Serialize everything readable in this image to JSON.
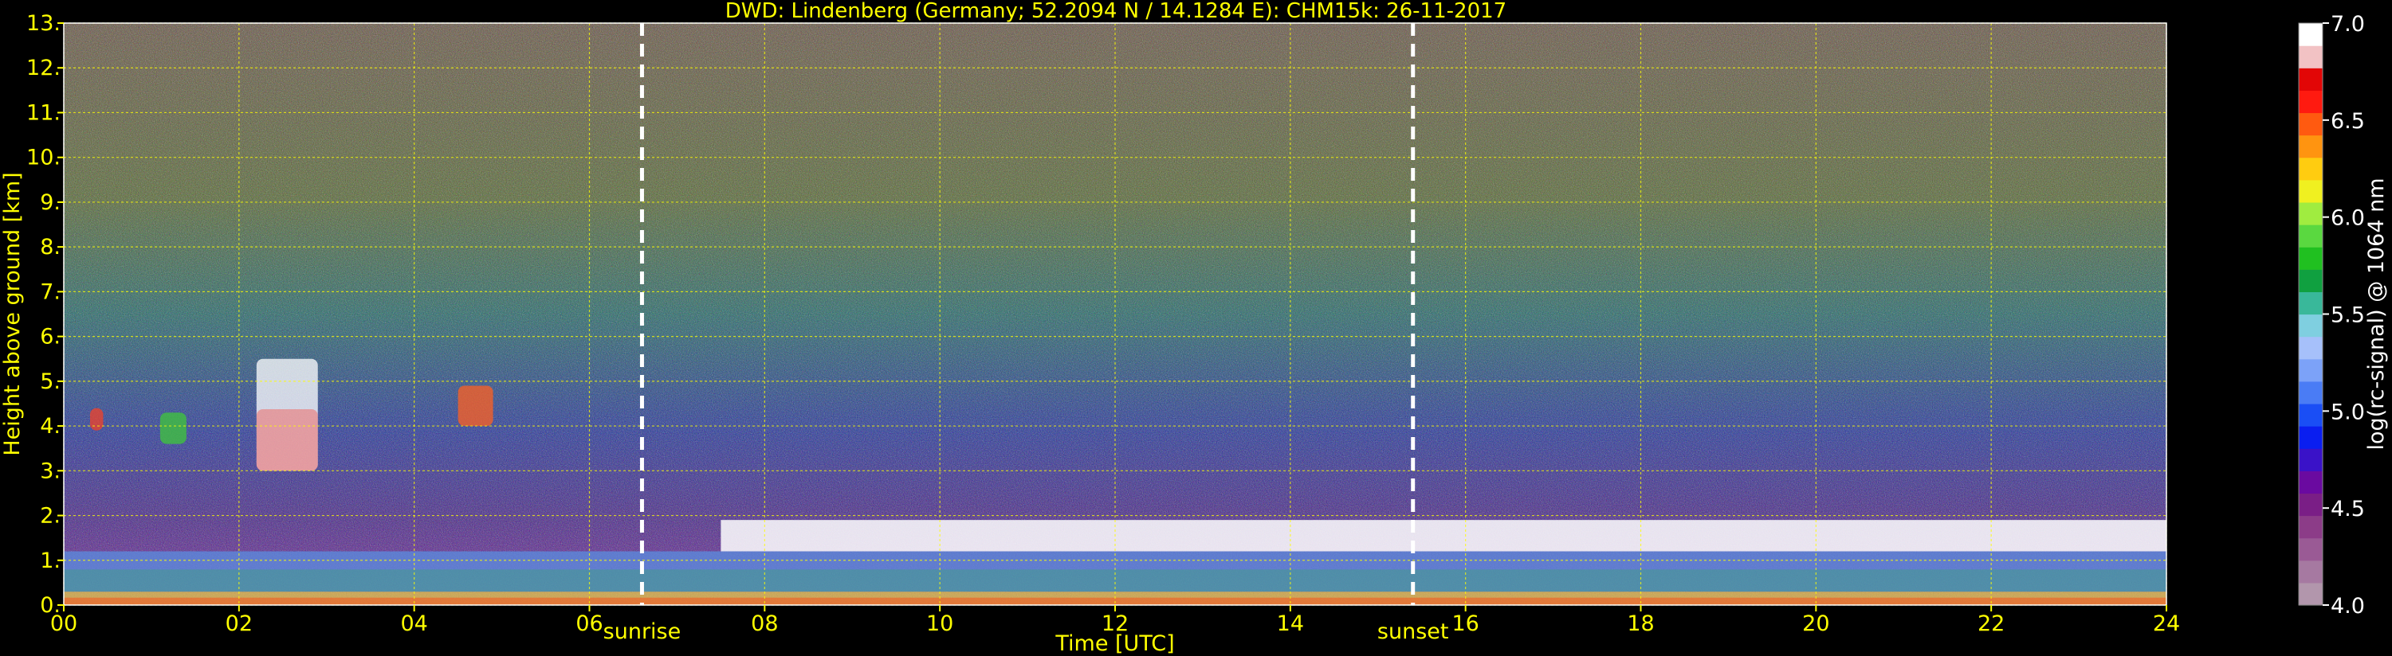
{
  "chart_data": {
    "type": "heatmap",
    "title": "DWD: Lindenberg (Germany; 52.2094 N / 14.1284 E):    CHM15k: 26-11-2017",
    "xlabel": "Time [UTC]",
    "ylabel": "Height above ground [km]",
    "xlim": [
      0,
      24
    ],
    "ylim": [
      0,
      13
    ],
    "x_ticks": [
      {
        "value": 0,
        "label": "00"
      },
      {
        "value": 2,
        "label": "02"
      },
      {
        "value": 4,
        "label": "04"
      },
      {
        "value": 6,
        "label": "06"
      },
      {
        "value": 8,
        "label": "08"
      },
      {
        "value": 10,
        "label": "10"
      },
      {
        "value": 12,
        "label": "12"
      },
      {
        "value": 14,
        "label": "14"
      },
      {
        "value": 16,
        "label": "16"
      },
      {
        "value": 18,
        "label": "18"
      },
      {
        "value": 20,
        "label": "20"
      },
      {
        "value": 22,
        "label": "22"
      },
      {
        "value": 24,
        "label": "24"
      }
    ],
    "y_ticks": [
      {
        "value": 0,
        "label": "0."
      },
      {
        "value": 1,
        "label": "1."
      },
      {
        "value": 2,
        "label": "2."
      },
      {
        "value": 3,
        "label": "3."
      },
      {
        "value": 4,
        "label": "4."
      },
      {
        "value": 5,
        "label": "5."
      },
      {
        "value": 6,
        "label": "6."
      },
      {
        "value": 7,
        "label": "7."
      },
      {
        "value": 8,
        "label": "8."
      },
      {
        "value": 9,
        "label": "9."
      },
      {
        "value": 10,
        "label": "10."
      },
      {
        "value": 11,
        "label": "11."
      },
      {
        "value": 12,
        "label": "12."
      },
      {
        "value": 13,
        "label": "13."
      }
    ],
    "grid": true,
    "grid_color": "#ffff00",
    "annotations": [
      {
        "label": "sunrise",
        "x": 6.6
      },
      {
        "label": "sunset",
        "x": 15.4
      }
    ],
    "colorbar": {
      "label": "log(rc-signal) @ 1064 nm",
      "range": [
        4.0,
        7.0
      ],
      "ticks": [
        {
          "value": 4.0,
          "label": "4.0"
        },
        {
          "value": 4.5,
          "label": "4.5"
        },
        {
          "value": 5.0,
          "label": "5.0"
        },
        {
          "value": 5.5,
          "label": "5.5"
        },
        {
          "value": 6.0,
          "label": "6.0"
        },
        {
          "value": 6.5,
          "label": "6.5"
        },
        {
          "value": 7.0,
          "label": "7.0"
        }
      ],
      "colors": [
        "#b296ac",
        "#a679a1",
        "#9a5a95",
        "#8c3c88",
        "#7a1e86",
        "#6a0aa0",
        "#3a12c8",
        "#0a1ef0",
        "#1a4ef5",
        "#4a7cf5",
        "#7ca2f8",
        "#a6c0fa",
        "#7fcfe0",
        "#39b89a",
        "#10a040",
        "#20c020",
        "#5ad840",
        "#a0ec40",
        "#f0f020",
        "#ffcc10",
        "#ff9410",
        "#ff5a10",
        "#ff1a10",
        "#e20606",
        "#f2c2c4",
        "#ffffff"
      ]
    },
    "layers": [
      {
        "name": "surface_layer",
        "x": [
          0,
          24
        ],
        "y": [
          0,
          0.3
        ]
      },
      {
        "name": "boundary_layer",
        "x": [
          0,
          24
        ],
        "y": [
          0.3,
          1.2
        ]
      },
      {
        "name": "cloud_top",
        "x": [
          7.5,
          24
        ],
        "y": [
          1.2,
          1.9
        ]
      },
      {
        "name": "cloud_2_3h",
        "x": [
          2.2,
          2.9
        ],
        "y": [
          3.0,
          5.5
        ]
      },
      {
        "name": "cloud_1h",
        "x": [
          1.1,
          1.4
        ],
        "y": [
          3.6,
          4.3
        ]
      },
      {
        "name": "cloud_4_6h",
        "x": [
          4.5,
          4.9
        ],
        "y": [
          4.0,
          4.9
        ]
      },
      {
        "name": "cloud_0_3h",
        "x": [
          0.3,
          0.45
        ],
        "y": [
          3.9,
          4.4
        ]
      }
    ]
  }
}
